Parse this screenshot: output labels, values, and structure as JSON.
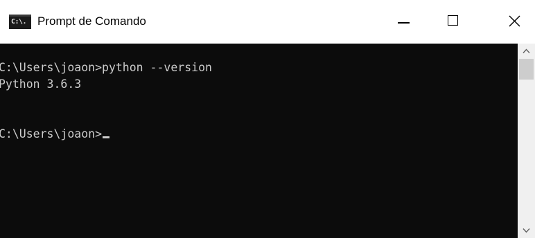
{
  "window": {
    "title": "Prompt de Comando",
    "icon_label": "C:\\."
  },
  "controls": {
    "minimize": "minimize-icon",
    "maximize": "maximize-icon",
    "close": "close-icon"
  },
  "console": {
    "line1": "C:\\Users\\joaon>python --version",
    "line2": "Python 3.6.3",
    "line3": "C:\\Users\\joaon>"
  },
  "colors": {
    "console_background": "#0c0c0c",
    "console_text": "#cccccc",
    "titlebar_background": "#ffffff"
  }
}
